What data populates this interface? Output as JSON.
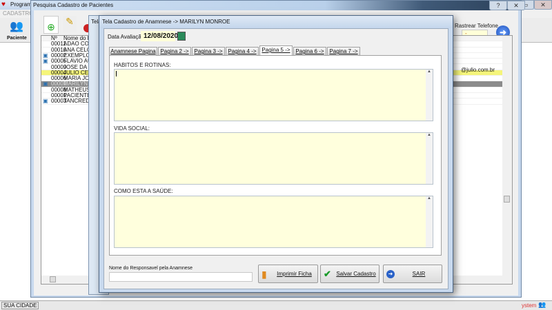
{
  "app": {
    "title": "Programa",
    "menu": "CADASTROS",
    "paciente_label": "Paciente",
    "status_city": "SUA CIDADE",
    "status_system": "ystem"
  },
  "search_window": {
    "title": "Pesquisa Cadastro de Pacientes",
    "help": "?",
    "close": "✕",
    "col_no": "Nº",
    "col_name": "Nome do Pa",
    "header_telefone": "Rastrear Telefone",
    "email_row": "@julio.com.br",
    "tele_hint": "Tela"
  },
  "patients": [
    {
      "no": "00011",
      "name": "ADAO CORR",
      "icon": false,
      "state": ""
    },
    {
      "no": "00010",
      "name": "ANA CELOI",
      "icon": false,
      "state": ""
    },
    {
      "no": "00002",
      "name": "EXEMPLO D",
      "icon": true,
      "state": ""
    },
    {
      "no": "00005",
      "name": "FLAVIO AU",
      "icon": true,
      "state": ""
    },
    {
      "no": "00009",
      "name": "JOSE DA SI",
      "icon": false,
      "state": ""
    },
    {
      "no": "00004",
      "name": "JULIO CESA",
      "icon": false,
      "state": "yellow"
    },
    {
      "no": "00006",
      "name": "MARIA JOS",
      "icon": false,
      "state": ""
    },
    {
      "no": "00007",
      "name": "MARILYN M",
      "icon": true,
      "state": "gray"
    },
    {
      "no": "00008",
      "name": "MATHEUS I",
      "icon": false,
      "state": ""
    },
    {
      "no": "00001",
      "name": "PACIENTE I",
      "icon": false,
      "state": ""
    },
    {
      "no": "00003",
      "name": "TANCREDO",
      "icon": true,
      "state": ""
    }
  ],
  "dialog": {
    "title": "Tela Cadastro de Anamnese -> MARILYN MONROE",
    "date_label": "Data Avaliação:",
    "date_value": "12/08/2020",
    "tabs": [
      "Anamnese Pagina 1 ->",
      "Pagina 2 ->",
      "Pagina 3 ->",
      "Pagina 4 ->",
      "Pagina 5 ->",
      "Pagina 6 ->",
      "Pagina 7 ->"
    ],
    "active_tab": 4,
    "fields": [
      {
        "label": "HABITOS E ROTINAS:",
        "value": ""
      },
      {
        "label": "VIDA SOCIAL:",
        "value": ""
      },
      {
        "label": "COMO ESTA A SAÚDE:",
        "value": ""
      }
    ],
    "responsible_label": "Nome do Responsavel pela Anamnese",
    "responsible_value": "",
    "print_button": "Imprimir Ficha",
    "save_button": "Salvar Cadastro",
    "exit_button": "SAIR"
  }
}
